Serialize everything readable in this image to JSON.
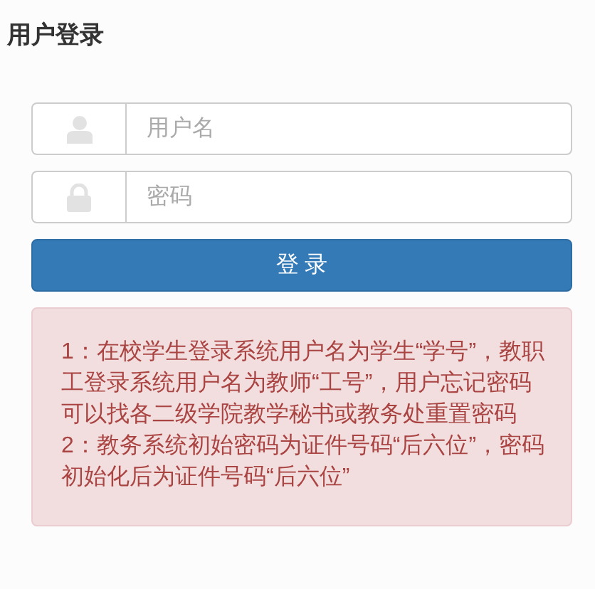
{
  "title": "用户登录",
  "fields": [
    {
      "kind": "user",
      "placeholder": "用户名"
    },
    {
      "kind": "lock",
      "placeholder": "密码"
    }
  ],
  "login_button": "登 录",
  "notice": [
    "1：在校学生登录系统用户名为学生“学号”，教职工登录系统用户名为教师“工号”，用户忘记密码可以找各二级学院教学秘书或教务处重置密码",
    "2：教务系统初始密码为证件号码“后六位”，密码初始化后为证件号码“后六位”"
  ]
}
